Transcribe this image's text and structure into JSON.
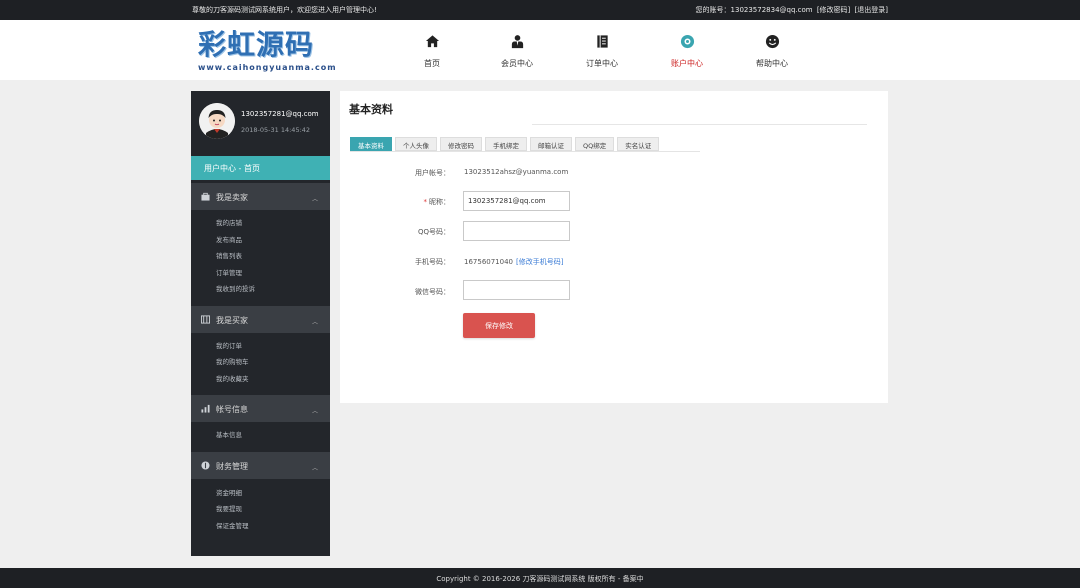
{
  "topbar": {
    "welcome": "尊敬的刀客源码测试网系统用户，欢迎您进入用户管理中心!",
    "account_label": "您的账号：13023572834@qq.com",
    "change_password": "[修改密码]",
    "logout": "[退出登录]"
  },
  "logo": {
    "text": "彩虹源码",
    "url_text": "www.caihongyuanma.com"
  },
  "nav": [
    {
      "label": "首页",
      "icon": "home-icon"
    },
    {
      "label": "会员中心",
      "icon": "member-icon"
    },
    {
      "label": "订单中心",
      "icon": "order-icon"
    },
    {
      "label": "账户中心",
      "icon": "account-icon"
    },
    {
      "label": "帮助中心",
      "icon": "help-icon"
    }
  ],
  "profile": {
    "username": "1302357281@qq.com",
    "time": "2018-05-31 14:45:42"
  },
  "sidebar": {
    "home": "用户中心 - 首页",
    "sections": [
      {
        "title": "我是卖家",
        "icon": "seller-icon",
        "items": [
          "我的店铺",
          "发布商品",
          "销售列表",
          "订单管理",
          "我收到的投诉"
        ]
      },
      {
        "title": "我是买家",
        "icon": "buyer-icon",
        "items": [
          "我的订单",
          "我的购物车",
          "我的收藏夹"
        ]
      },
      {
        "title": "帐号信息",
        "icon": "account-info-icon",
        "items": [
          "基本信息"
        ]
      },
      {
        "title": "财务管理",
        "icon": "finance-icon",
        "items": [
          "资金明细",
          "我要提现",
          "保证金管理"
        ]
      }
    ]
  },
  "panel": {
    "title": "基本资料",
    "tabs": [
      "基本资料",
      "个人头像",
      "修改密码",
      "手机绑定",
      "邮箱认证",
      "QQ绑定",
      "实名认证"
    ],
    "active_tab": 0,
    "fields": {
      "account_label": "用户帐号：",
      "account_value": "13023512ahsz@yuanma.com",
      "nickname_label": "昵称：",
      "nickname_value": "1302357281@qq.com",
      "qq_label": "QQ号码：",
      "qq_value": "",
      "phone_label": "手机号码：",
      "phone_value": "16756071040",
      "phone_link": "[修改手机号码]",
      "wechat_label": "微信号码：",
      "wechat_value": ""
    },
    "save_label": "保存修改"
  },
  "footer": {
    "text": "Copyright © 2016-2026 刀客源码测试网系统 版权所有 - 备案中"
  },
  "colors": {
    "accent": "#3fb1b4",
    "danger": "#d9534f",
    "dark": "#1e2024",
    "sidebar": "#23262b"
  }
}
